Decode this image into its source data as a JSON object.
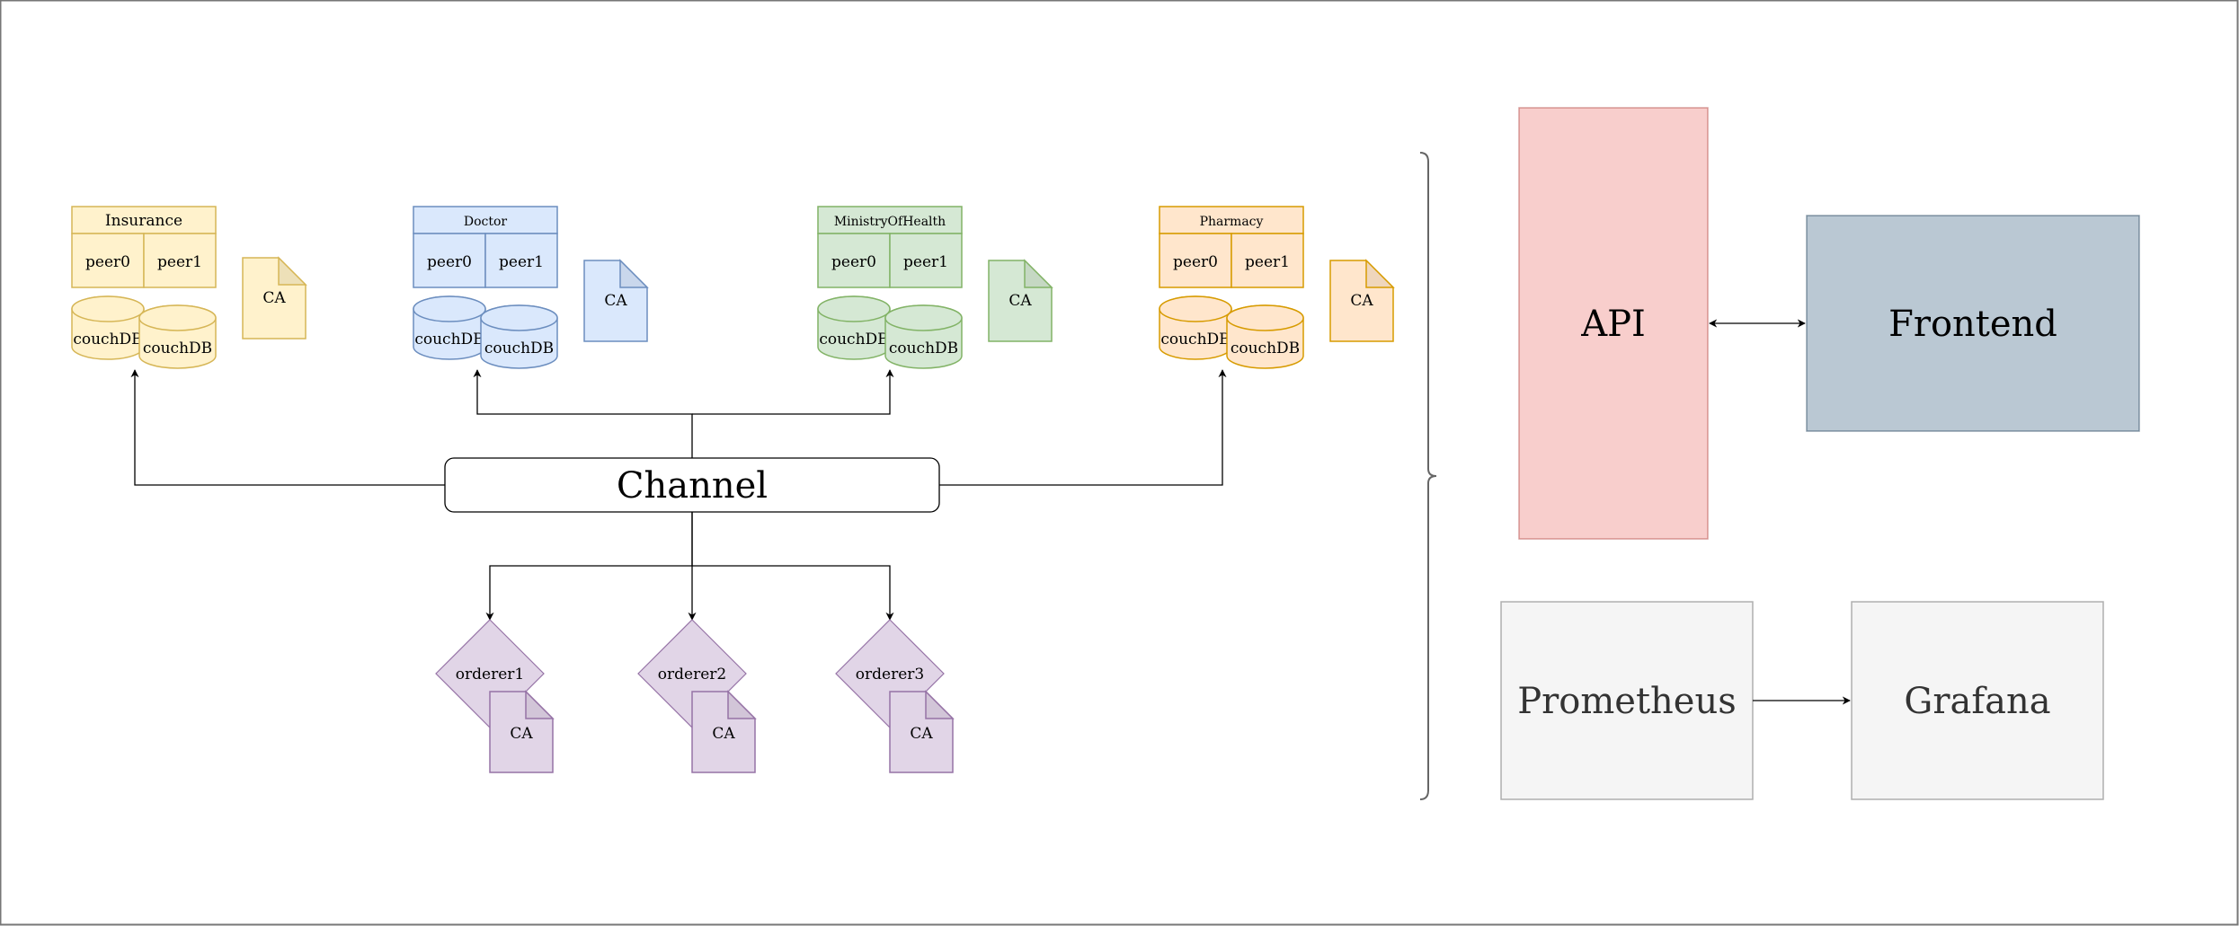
{
  "organizations": [
    {
      "name": "Insurance",
      "peers": [
        "peer0",
        "peer1"
      ],
      "databases": [
        "couchDB",
        "couchDB"
      ],
      "ca_label": "CA",
      "colors": {
        "fill": "#fff2cc",
        "stroke": "#d6b656",
        "fold": "#ede0b8"
      }
    },
    {
      "name": "Doctor",
      "peers": [
        "peer0",
        "peer1"
      ],
      "databases": [
        "couchDB",
        "couchDB"
      ],
      "ca_label": "CA",
      "colors": {
        "fill": "#dae8fc",
        "stroke": "#6c8ebf",
        "fold": "#c9d7ec"
      }
    },
    {
      "name": "MinistryOfHealth",
      "peers": [
        "peer0",
        "peer1"
      ],
      "databases": [
        "couchDB",
        "couchDB"
      ],
      "ca_label": "CA",
      "colors": {
        "fill": "#d5e8d4",
        "stroke": "#82b366",
        "fold": "#c5d8c3"
      }
    },
    {
      "name": "Pharmacy",
      "peers": [
        "peer0",
        "peer1"
      ],
      "databases": [
        "couchDB",
        "couchDB"
      ],
      "ca_label": "CA",
      "colors": {
        "fill": "#ffe6cc",
        "stroke": "#d79b00",
        "fold": "#efd6bc"
      }
    }
  ],
  "channel": {
    "label": "Channel"
  },
  "orderers": [
    {
      "name": "orderer1",
      "ca_label": "CA"
    },
    {
      "name": "orderer2",
      "ca_label": "CA"
    },
    {
      "name": "orderer3",
      "ca_label": "CA"
    }
  ],
  "orderer_colors": {
    "fill": "#e1d5e7",
    "stroke": "#9673a6",
    "fold": "#d2c5d8"
  },
  "services": {
    "api": {
      "label": "API",
      "fill": "#f8cecc",
      "stroke": "#b85450"
    },
    "frontend": {
      "label": "Frontend",
      "fill": "#bac8d3",
      "stroke": "#23445d"
    },
    "prometheus": {
      "label": "Prometheus",
      "fill": "#f5f5f5",
      "stroke": "#666666"
    },
    "grafana": {
      "label": "Grafana",
      "fill": "#f5f5f5",
      "stroke": "#666666"
    }
  }
}
